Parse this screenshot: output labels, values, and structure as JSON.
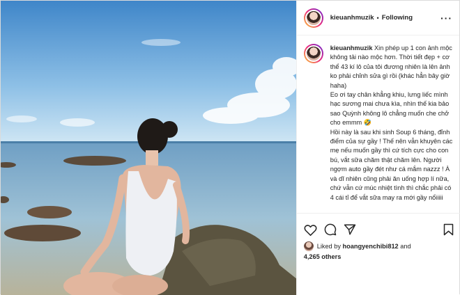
{
  "header": {
    "username": "kieuanhmuzik",
    "separator": "•",
    "follow_label": "Following",
    "more_label": "···",
    "avatar_icon": "profile-avatar",
    "more_icon": "more-options-icon"
  },
  "caption": {
    "username": "kieuanhmuzik",
    "text": "Xin phép up 1 con ảnh mộc không tải nào mộc hơn. Thời tiết đẹp + cơ thể 43 kí lô của tôi đương nhiên là lên ảnh ko phải chỉnh sửa gì rồi (khác hẳn bây giờ haha)\nEo ơi tay chân khẳng khiu, lưng liếc mình hạc sương mai chưa kìa, nhìn thế kia bảo sao Quỳnh không lô chẳng muốn che chở cho emmm 🤣\nHồi này là sau khi sinh Soup 6 tháng, đỉnh điểm của sự gầy ! Thế nên vẫn khuyên các mẹ nếu muốn gầy thì cứ tích cực cho con bú, vắt sữa chăm thật chăm lên. Người ngợm auto gầy đét như cá mắm nazzz ! À và dĩ nhiên cũng phải ăn uống hợp lí nữa, chứ vẫn cứ múc nhiệt tình thì chắc phải có 4 cái tỉ để vắt sữa may ra mới gầy nổiiiii"
  },
  "actions": {
    "icons": [
      "heart-icon",
      "comment-icon",
      "share-icon",
      "bookmark-icon"
    ]
  },
  "likes": {
    "liked_by_prefix": "Liked by",
    "liked_by_user": "hoangyenchibi812",
    "and": "and",
    "others_count": "4,265 others"
  },
  "colors": {
    "text": "#262626",
    "border": "#dbdbdb",
    "story_ring_start": "#f9ce34",
    "story_ring_end": "#6228d7"
  }
}
